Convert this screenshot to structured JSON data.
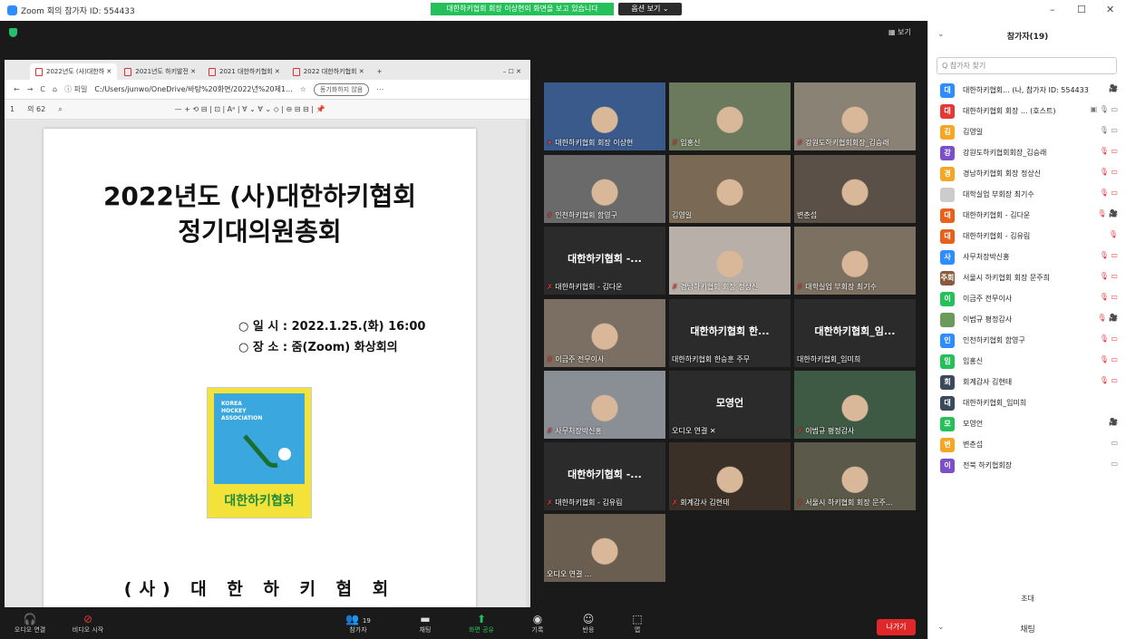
{
  "titlebar": {
    "app_title": "Zoom 회의 참가자 ID: 554433",
    "share_banner": "대한하키협회 회장 이상현의 화면을 보고 있습니다",
    "view_options": "옵션 보기 ⌄",
    "min": "–",
    "max": "☐",
    "close": "✕"
  },
  "stage": {
    "view_label": "▦ 보기"
  },
  "browser": {
    "tabs": [
      "2022년도 (사)대한하 ✕",
      "2021년도 하키발전 ✕",
      "2021 대한하키협회 ✕",
      "2022 대한하키협회 ✕",
      "+"
    ],
    "win_controls": "–  ☐  ✕",
    "url_prefix": "ⓘ 파일",
    "url": "C:/Users/junwo/OneDrive/바탕%20화면/2022년%20제1...",
    "sync": "동기화하지 않음",
    "page_num": "1",
    "page_total": "의 62",
    "toolbar_icons": "—  +  ⟲  ⊟  |  ⊡  |  Aᵃ  |  ∀  ⌄  ∀  ⌄  ◇  |  ⊖  ⊟  ⊟  |  📌"
  },
  "document": {
    "title_line1": "2022년도 (사)대한하키협회",
    "title_line2": "정기대의원총회",
    "info_line1": "○ 일 시 : 2022.1.25.(화) 16:00",
    "info_line2": "○ 장 소 : 줌(Zoom) 화상회의",
    "logo_text_1": "KOREA",
    "logo_text_2": "HOCKEY",
    "logo_text_3": "ASSOCIATION",
    "logo_name": "대한하키협회",
    "footer": "(사) 대 한 하 키 협 회"
  },
  "tiles": [
    {
      "name": "대한하키협회 회장 이상현",
      "pin": true,
      "center": "",
      "video": "#3a5a8c",
      "active": true
    },
    {
      "name": "임홍신",
      "center": "",
      "video": "#6b7a5c"
    },
    {
      "name": "강원도하키협회회장_김승래",
      "center": "",
      "video": "#8a8275"
    },
    {
      "name": "인천하키협회 함영구",
      "center": "",
      "video": "#6a6a6a"
    },
    {
      "name": "김영일",
      "center": "",
      "video": "#7a6a55",
      "nomic": true
    },
    {
      "name": "변춘섭",
      "center": "",
      "video": "#5a5048",
      "nomic": true
    },
    {
      "name": "대한하키협회 - 김다운",
      "center": "대한하키협회 -...",
      "video": ""
    },
    {
      "name": "경남하키협회 회장 정상신",
      "center": "",
      "video": "#b8b0a8"
    },
    {
      "name": "대학실업 부회장 최기수",
      "center": "",
      "video": "#7c7060"
    },
    {
      "name": "이금주 전무이사",
      "center": "",
      "video": "#7a6f62"
    },
    {
      "name": "대한하키협회 한승훈 주무",
      "center": "대한하키협회 한...",
      "video": "",
      "nomic": true
    },
    {
      "name": "대한하키협회_임미희",
      "center": "대한하키협회_임...",
      "video": "",
      "nomic": true
    },
    {
      "name": "사무처장박신홍",
      "center": "",
      "video": "#8a8f96"
    },
    {
      "name": "오디오 연결 ✕",
      "center": "모영언",
      "video": "",
      "nomic": true
    },
    {
      "name": "이범규 평정감사",
      "center": "",
      "video": "#3f5a44"
    },
    {
      "name": "대한하키협회 - 김유림",
      "center": "대한하키협회 -...",
      "video": ""
    },
    {
      "name": "회계감사 김현태",
      "center": "",
      "video": "#3a3028"
    },
    {
      "name": "서울시 하키협회 회장 문주...",
      "center": "",
      "video": "#5b5a4a"
    },
    {
      "name": "오디오 연결 ...",
      "center": "",
      "video": "#6a5e50",
      "nomic": true
    }
  ],
  "toolbar": {
    "audio": "오디오 연결",
    "video": "비디오 시작",
    "participants": "참가자",
    "participants_count": "19",
    "chat": "채팅",
    "share": "화면 공유",
    "record": "기록",
    "reactions": "반응",
    "apps": "앱",
    "leave": "나가기"
  },
  "panel": {
    "title": "참가자(19)",
    "search_placeholder": "Q 참가자 찾기",
    "invite": "초대",
    "chat": "채팅",
    "participants": [
      {
        "initial": "대",
        "color": "#2d8cff",
        "name": "대한하키협회... (나, 참가자 ID: 554433)",
        "icons": "🎥",
        "muted": true
      },
      {
        "initial": "대",
        "color": "#e53935",
        "name": "대한하키협회 회장 ... (호스트)",
        "icons": "▣ 🎙 ▭",
        "muted": false
      },
      {
        "initial": "김",
        "color": "#f5a623",
        "name": "김영일",
        "icons": "🎙 ▭",
        "muted": false
      },
      {
        "initial": "강",
        "color": "#7b4fc9",
        "name": "강원도하키협회회장_김승래",
        "icons": "🎙 ▭",
        "muted": true
      },
      {
        "initial": "경",
        "color": "#f5a623",
        "name": "경남하키협회 회장 정상신",
        "icons": "🎙 ▭",
        "muted": true
      },
      {
        "initial": "",
        "color": "#ccc",
        "name": "대학실업 부회장 최기수",
        "icons": "🎙 ▭",
        "muted": true
      },
      {
        "initial": "대",
        "color": "#e8601c",
        "name": "대한하키협회 - 김다운",
        "icons": "🎙 🎥",
        "muted": true
      },
      {
        "initial": "대",
        "color": "#e8601c",
        "name": "대한하키협회 - 김유림",
        "icons": "🎙",
        "muted": true
      },
      {
        "initial": "사",
        "color": "#2d8cff",
        "name": "사무처장박신홍",
        "icons": "🎙 ▭",
        "muted": true
      },
      {
        "initial": "주회",
        "color": "#8a5a3c",
        "name": "서울시 하키협회 회장 문주희",
        "icons": "🎙 ▭",
        "muted": true
      },
      {
        "initial": "이",
        "color": "#25c05a",
        "name": "이금주 전무이사",
        "icons": "🎙 ▭",
        "muted": true
      },
      {
        "initial": "",
        "color": "#6b9a5a",
        "name": "이범규 평정감사",
        "icons": "🎙 🎥",
        "muted": true
      },
      {
        "initial": "인",
        "color": "#2d8cff",
        "name": "인천하키협회 함영구",
        "icons": "🎙 ▭",
        "muted": true
      },
      {
        "initial": "임",
        "color": "#25c05a",
        "name": "임홍신",
        "icons": "🎙 ▭",
        "muted": true
      },
      {
        "initial": "회",
        "color": "#3a4a5c",
        "name": "회계감사 김현태",
        "icons": "🎙 ▭",
        "muted": true
      },
      {
        "initial": "대",
        "color": "#3a4a5c",
        "name": "대한하키협회_임미희",
        "icons": "",
        "muted": false
      },
      {
        "initial": "모",
        "color": "#25c05a",
        "name": "모영언",
        "icons": "🎥",
        "muted": true
      },
      {
        "initial": "변",
        "color": "#f5a623",
        "name": "변춘섭",
        "icons": "▭",
        "muted": false
      },
      {
        "initial": "이",
        "color": "#7b4fc9",
        "name": "전북 하키협회장",
        "icons": "▭",
        "muted": false
      }
    ]
  }
}
